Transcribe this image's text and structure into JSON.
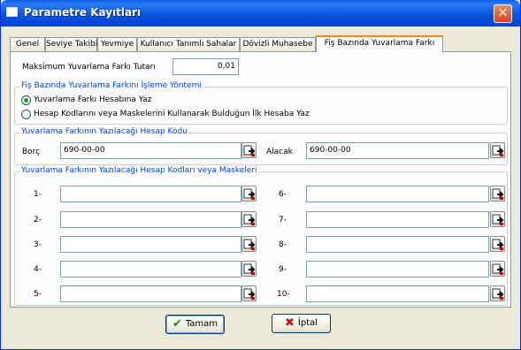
{
  "window": {
    "title": "Parametre Kayıtları",
    "close_label": "✕"
  },
  "tabs": [
    {
      "label": "Genel"
    },
    {
      "label": "Seviye Takibi"
    },
    {
      "label": "Yevmiye"
    },
    {
      "label": "Kullanıcı Tanımlı Sahalar"
    },
    {
      "label": "Dövizli Muhasebe"
    },
    {
      "label": "Fiş Bazında Yuvarlama Farkı",
      "active": true
    }
  ],
  "max_diff": {
    "label": "Maksimum Yuvarlama Farkı Tutarı",
    "value": "0,01"
  },
  "method_group": {
    "title": "Fiş Bazında Yuvarlama Farkını İşleme Yöntemi",
    "options": [
      {
        "label": "Yuvarlama Farkı Hesabına Yaz",
        "checked": true
      },
      {
        "label": "Hesap Kodlarını veya Maskelerini Kullanarak Bulduğun İlk Hesaba Yaz",
        "checked": false
      }
    ]
  },
  "account_group": {
    "title": "Yuvarlama Farkının Yazılacağı Hesap Kodu",
    "borc_label": "Borç",
    "borc_value": "690-00-00",
    "alacak_label": "Alacak",
    "alacak_value": "690-00-00"
  },
  "masks_group": {
    "title": "Yuvarlama Farkının Yazılacağı Hesap Kodları veya Maskeleri",
    "left_labels": [
      "1-",
      "2-",
      "3-",
      "4-",
      "5-"
    ],
    "right_labels": [
      "6-",
      "7-",
      "8-",
      "9-",
      "10-"
    ],
    "left_values": [
      "",
      "",
      "",
      "",
      ""
    ],
    "right_values": [
      "",
      "",
      "",
      "",
      ""
    ]
  },
  "buttons": {
    "ok": "Tamam",
    "cancel": "İptal"
  }
}
